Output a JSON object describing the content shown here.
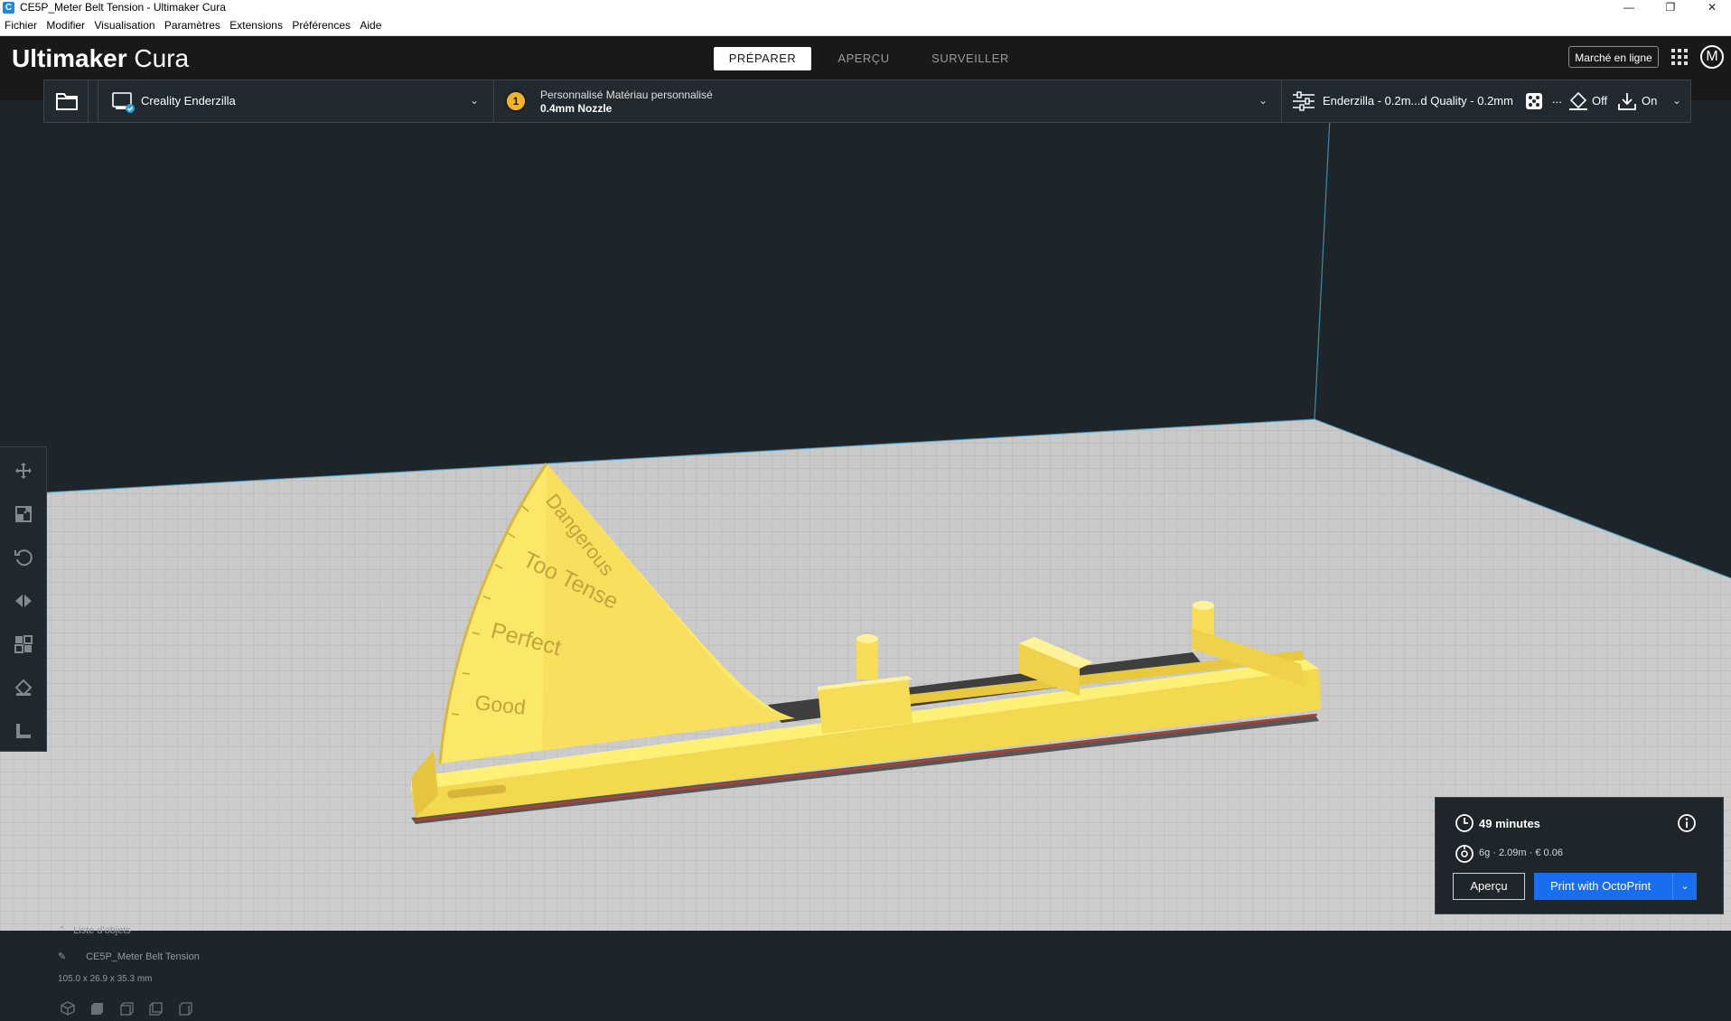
{
  "window": {
    "title": "CE5P_Meter Belt Tension - Ultimaker Cura",
    "app_icon": "C",
    "controls": {
      "minimize": "—",
      "maximize": "❐",
      "close": "✕"
    }
  },
  "menu": [
    "Fichier",
    "Modifier",
    "Visualisation",
    "Paramètres",
    "Extensions",
    "Préférences",
    "Aide"
  ],
  "header": {
    "logo_brand": "Ultimaker",
    "logo_product": "Cura",
    "stages": [
      "PRÉPARER",
      "APERÇU",
      "SURVEILLER"
    ],
    "active_stage": "PRÉPARER",
    "marketplace_label": "Marché en ligne",
    "avatar_letter": "M"
  },
  "toolbar": {
    "printer_name": "Creality Enderzilla",
    "extruder_number": "1",
    "extruder_material": "Personnalisé Matériau personnalisé",
    "extruder_nozzle": "0.4mm Nozzle",
    "quality_profile": "Enderzilla - 0.2m...d Quality - 0.2mm",
    "support_more": "...",
    "adhesion_state": "Off",
    "infill_state": "On"
  },
  "model": {
    "labels": [
      "Dangerous",
      "Too Tense",
      "Perfect",
      "Good"
    ],
    "color": "#f7e25c"
  },
  "object_list": {
    "title": "Liste d'objets",
    "object_name": "CE5P_Meter Belt Tension",
    "dimensions": "105.0 x 26.9 x 35.3 mm"
  },
  "action_panel": {
    "print_time": "49 minutes",
    "material_estimate": "6g · 2.09m · € 0.06",
    "preview_button": "Aperçu",
    "print_button": "Print with OctoPrint",
    "accent_color": "#196ef0"
  }
}
